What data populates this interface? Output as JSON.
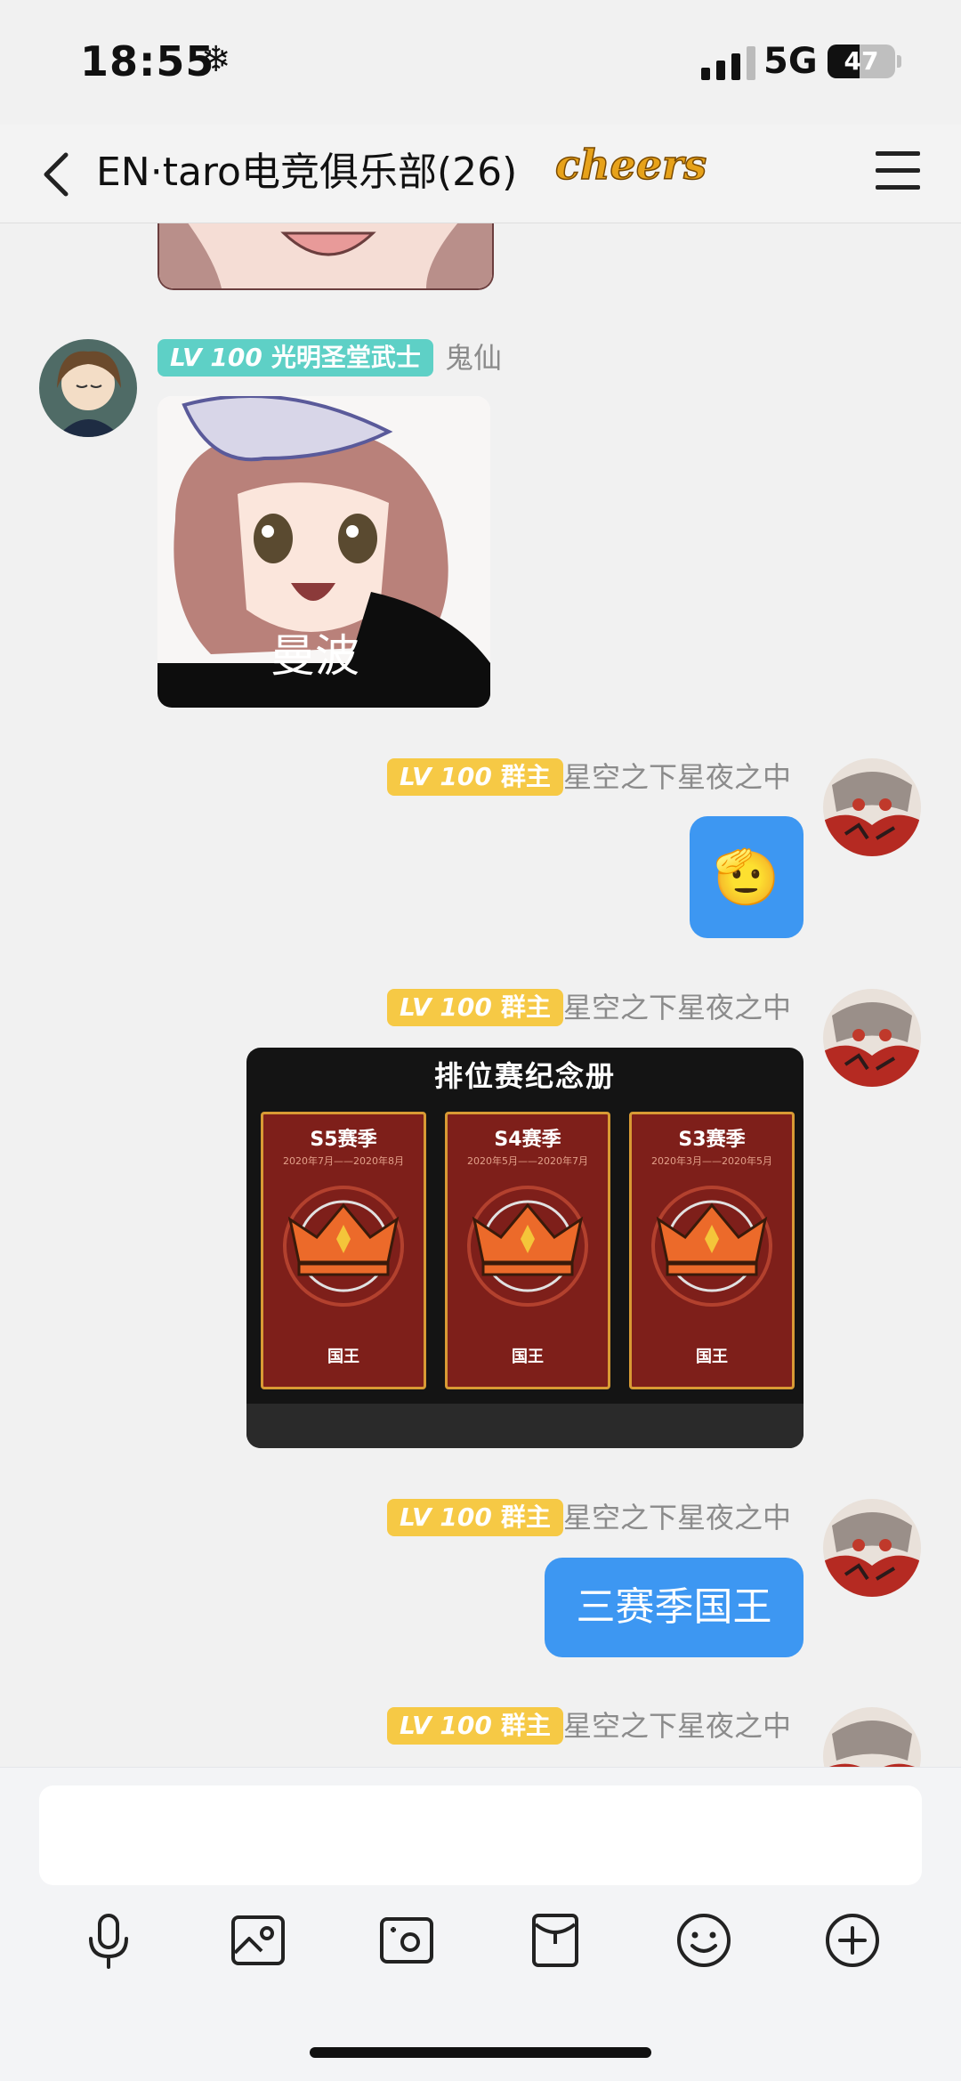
{
  "status_bar": {
    "time": "18:55",
    "weather_icon": "snowflake",
    "network": "5G",
    "battery_level": "47",
    "battery_fraction": 0.47
  },
  "header": {
    "title": "EN·taro电竞俱乐部(26)",
    "badge_text": "cheers",
    "back_icon": "chevron-left-icon",
    "menu_icon": "hamburger-menu-icon"
  },
  "messages": [
    {
      "type": "sticker",
      "side": "left",
      "partial": true
    },
    {
      "type": "sticker",
      "side": "left",
      "level": "LV 100",
      "title": "光明圣堂武士",
      "sender": "鬼仙",
      "caption": "曼波"
    },
    {
      "type": "emoji",
      "side": "right",
      "level": "LV 100",
      "title": "群主",
      "sender": "星空之下星夜之中",
      "emoji": "🫡"
    },
    {
      "type": "image",
      "side": "right",
      "level": "LV 100",
      "title": "群主",
      "sender": "星空之下星夜之中",
      "image": {
        "heading": "排位赛纪念册",
        "cards": [
          {
            "season": "S5赛季",
            "dates": "2020年7月——2020年8月",
            "rank": "国王"
          },
          {
            "season": "S4赛季",
            "dates": "2020年5月——2020年7月",
            "rank": "国王"
          },
          {
            "season": "S3赛季",
            "dates": "2020年3月——2020年5月",
            "rank": "国王"
          }
        ]
      }
    },
    {
      "type": "text",
      "side": "right",
      "level": "LV 100",
      "title": "群主",
      "sender": "星空之下星夜之中",
      "text": "三赛季国王"
    },
    {
      "type": "text",
      "side": "right",
      "level": "LV 100",
      "title": "群主",
      "sender": "星空之下星夜之中",
      "partial": true
    }
  ],
  "input": {
    "placeholder": ""
  },
  "toolbar": [
    "microphone-icon",
    "photo-icon",
    "camera-icon",
    "red-packet-icon",
    "emoji-icon",
    "plus-icon"
  ],
  "colors": {
    "bubble": "#3d97f2",
    "tag_teal": "#5ed0c6",
    "tag_gold": "#f6c945",
    "nick": "#8b8b8b"
  }
}
